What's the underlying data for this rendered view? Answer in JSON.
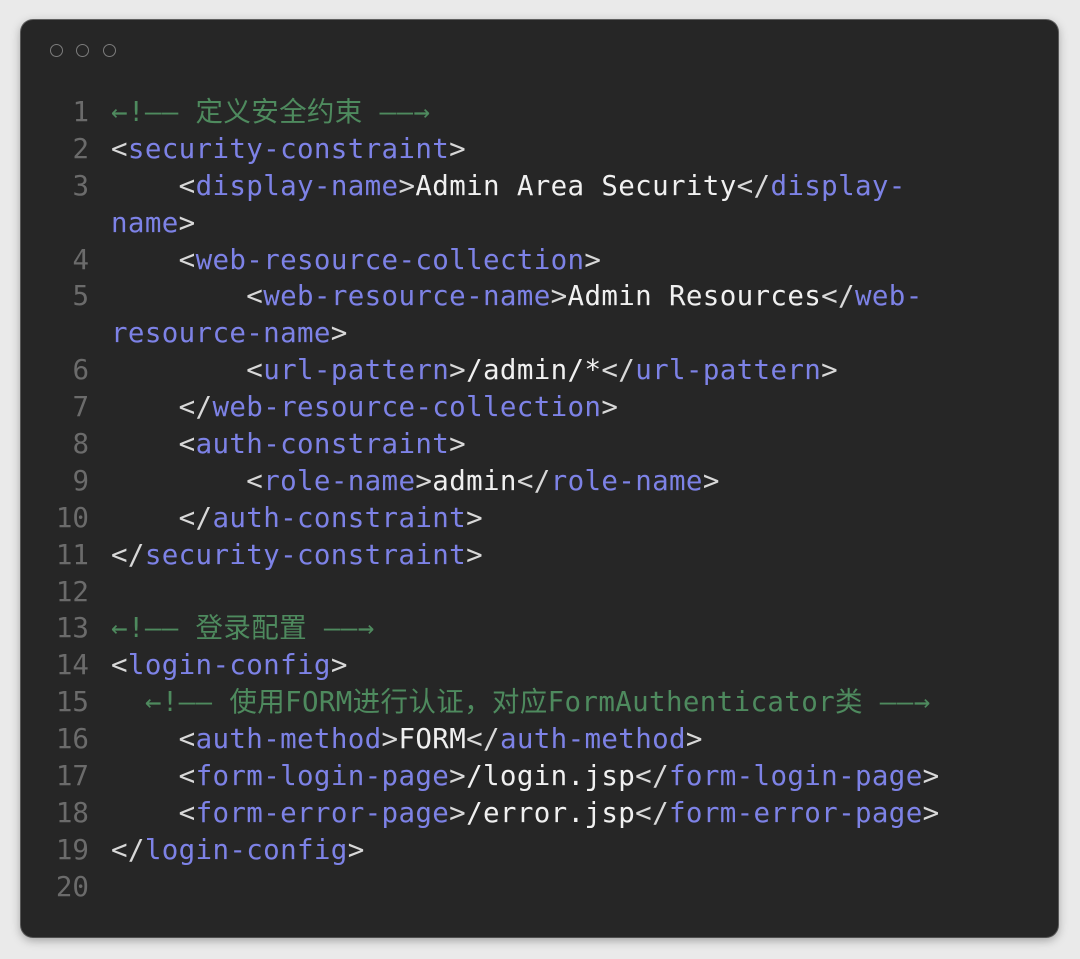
{
  "window": {
    "title_dots": [
      "close",
      "minimize",
      "zoom"
    ]
  },
  "colors": {
    "background": "#262626",
    "line_number": "#6b6b6b",
    "tag": "#7d82e6",
    "punctuation": "#d8d8d8",
    "text": "#f0f0f0",
    "comment": "#4e8a5e"
  },
  "code": {
    "lines": [
      {
        "n": "1",
        "tokens": [
          {
            "k": "c",
            "t": "←!—— 定义安全约束 ——→"
          }
        ]
      },
      {
        "n": "2",
        "tokens": [
          {
            "k": "p",
            "t": "<"
          },
          {
            "k": "t",
            "t": "security-constraint"
          },
          {
            "k": "p",
            "t": ">"
          }
        ]
      },
      {
        "n": "3",
        "tokens": [
          {
            "k": "x",
            "t": "    "
          },
          {
            "k": "p",
            "t": "<"
          },
          {
            "k": "t",
            "t": "display-name"
          },
          {
            "k": "p",
            "t": ">"
          },
          {
            "k": "x",
            "t": "Admin Area Security"
          },
          {
            "k": "p",
            "t": "</"
          },
          {
            "k": "t",
            "t": "display-"
          }
        ]
      },
      {
        "n": "",
        "tokens": [
          {
            "k": "t",
            "t": "name"
          },
          {
            "k": "p",
            "t": ">"
          }
        ]
      },
      {
        "n": "4",
        "tokens": [
          {
            "k": "x",
            "t": "    "
          },
          {
            "k": "p",
            "t": "<"
          },
          {
            "k": "t",
            "t": "web-resource-collection"
          },
          {
            "k": "p",
            "t": ">"
          }
        ]
      },
      {
        "n": "5",
        "tokens": [
          {
            "k": "x",
            "t": "        "
          },
          {
            "k": "p",
            "t": "<"
          },
          {
            "k": "t",
            "t": "web-resource-name"
          },
          {
            "k": "p",
            "t": ">"
          },
          {
            "k": "x",
            "t": "Admin Resources"
          },
          {
            "k": "p",
            "t": "</"
          },
          {
            "k": "t",
            "t": "web-"
          }
        ]
      },
      {
        "n": "",
        "tokens": [
          {
            "k": "t",
            "t": "resource-name"
          },
          {
            "k": "p",
            "t": ">"
          }
        ]
      },
      {
        "n": "6",
        "tokens": [
          {
            "k": "x",
            "t": "        "
          },
          {
            "k": "p",
            "t": "<"
          },
          {
            "k": "t",
            "t": "url-pattern"
          },
          {
            "k": "p",
            "t": ">"
          },
          {
            "k": "x",
            "t": "/admin/*"
          },
          {
            "k": "p",
            "t": "</"
          },
          {
            "k": "t",
            "t": "url-pattern"
          },
          {
            "k": "p",
            "t": ">"
          }
        ]
      },
      {
        "n": "7",
        "tokens": [
          {
            "k": "x",
            "t": "    "
          },
          {
            "k": "p",
            "t": "</"
          },
          {
            "k": "t",
            "t": "web-resource-collection"
          },
          {
            "k": "p",
            "t": ">"
          }
        ]
      },
      {
        "n": "8",
        "tokens": [
          {
            "k": "x",
            "t": "    "
          },
          {
            "k": "p",
            "t": "<"
          },
          {
            "k": "t",
            "t": "auth-constraint"
          },
          {
            "k": "p",
            "t": ">"
          }
        ]
      },
      {
        "n": "9",
        "tokens": [
          {
            "k": "x",
            "t": "        "
          },
          {
            "k": "p",
            "t": "<"
          },
          {
            "k": "t",
            "t": "role-name"
          },
          {
            "k": "p",
            "t": ">"
          },
          {
            "k": "x",
            "t": "admin"
          },
          {
            "k": "p",
            "t": "</"
          },
          {
            "k": "t",
            "t": "role-name"
          },
          {
            "k": "p",
            "t": ">"
          }
        ]
      },
      {
        "n": "10",
        "tokens": [
          {
            "k": "x",
            "t": "    "
          },
          {
            "k": "p",
            "t": "</"
          },
          {
            "k": "t",
            "t": "auth-constraint"
          },
          {
            "k": "p",
            "t": ">"
          }
        ]
      },
      {
        "n": "11",
        "tokens": [
          {
            "k": "p",
            "t": "</"
          },
          {
            "k": "t",
            "t": "security-constraint"
          },
          {
            "k": "p",
            "t": ">"
          }
        ]
      },
      {
        "n": "12",
        "tokens": []
      },
      {
        "n": "13",
        "tokens": [
          {
            "k": "c",
            "t": "←!—— 登录配置 ——→"
          }
        ]
      },
      {
        "n": "14",
        "tokens": [
          {
            "k": "p",
            "t": "<"
          },
          {
            "k": "t",
            "t": "login-config"
          },
          {
            "k": "p",
            "t": ">"
          }
        ]
      },
      {
        "n": "15",
        "tokens": [
          {
            "k": "c",
            "t": "  ←!—— 使用FORM进行认证，对应FormAuthenticator类 ——→"
          }
        ]
      },
      {
        "n": "16",
        "tokens": [
          {
            "k": "x",
            "t": "    "
          },
          {
            "k": "p",
            "t": "<"
          },
          {
            "k": "t",
            "t": "auth-method"
          },
          {
            "k": "p",
            "t": ">"
          },
          {
            "k": "x",
            "t": "FORM"
          },
          {
            "k": "p",
            "t": "</"
          },
          {
            "k": "t",
            "t": "auth-method"
          },
          {
            "k": "p",
            "t": ">"
          }
        ]
      },
      {
        "n": "17",
        "tokens": [
          {
            "k": "x",
            "t": "    "
          },
          {
            "k": "p",
            "t": "<"
          },
          {
            "k": "t",
            "t": "form-login-page"
          },
          {
            "k": "p",
            "t": ">"
          },
          {
            "k": "x",
            "t": "/login.jsp"
          },
          {
            "k": "p",
            "t": "</"
          },
          {
            "k": "t",
            "t": "form-login-page"
          },
          {
            "k": "p",
            "t": ">"
          }
        ]
      },
      {
        "n": "18",
        "tokens": [
          {
            "k": "x",
            "t": "    "
          },
          {
            "k": "p",
            "t": "<"
          },
          {
            "k": "t",
            "t": "form-error-page"
          },
          {
            "k": "p",
            "t": ">"
          },
          {
            "k": "x",
            "t": "/error.jsp"
          },
          {
            "k": "p",
            "t": "</"
          },
          {
            "k": "t",
            "t": "form-error-page"
          },
          {
            "k": "p",
            "t": ">"
          }
        ]
      },
      {
        "n": "19",
        "tokens": [
          {
            "k": "p",
            "t": "</"
          },
          {
            "k": "t",
            "t": "login-config"
          },
          {
            "k": "p",
            "t": ">"
          }
        ]
      },
      {
        "n": "20",
        "tokens": []
      }
    ]
  }
}
